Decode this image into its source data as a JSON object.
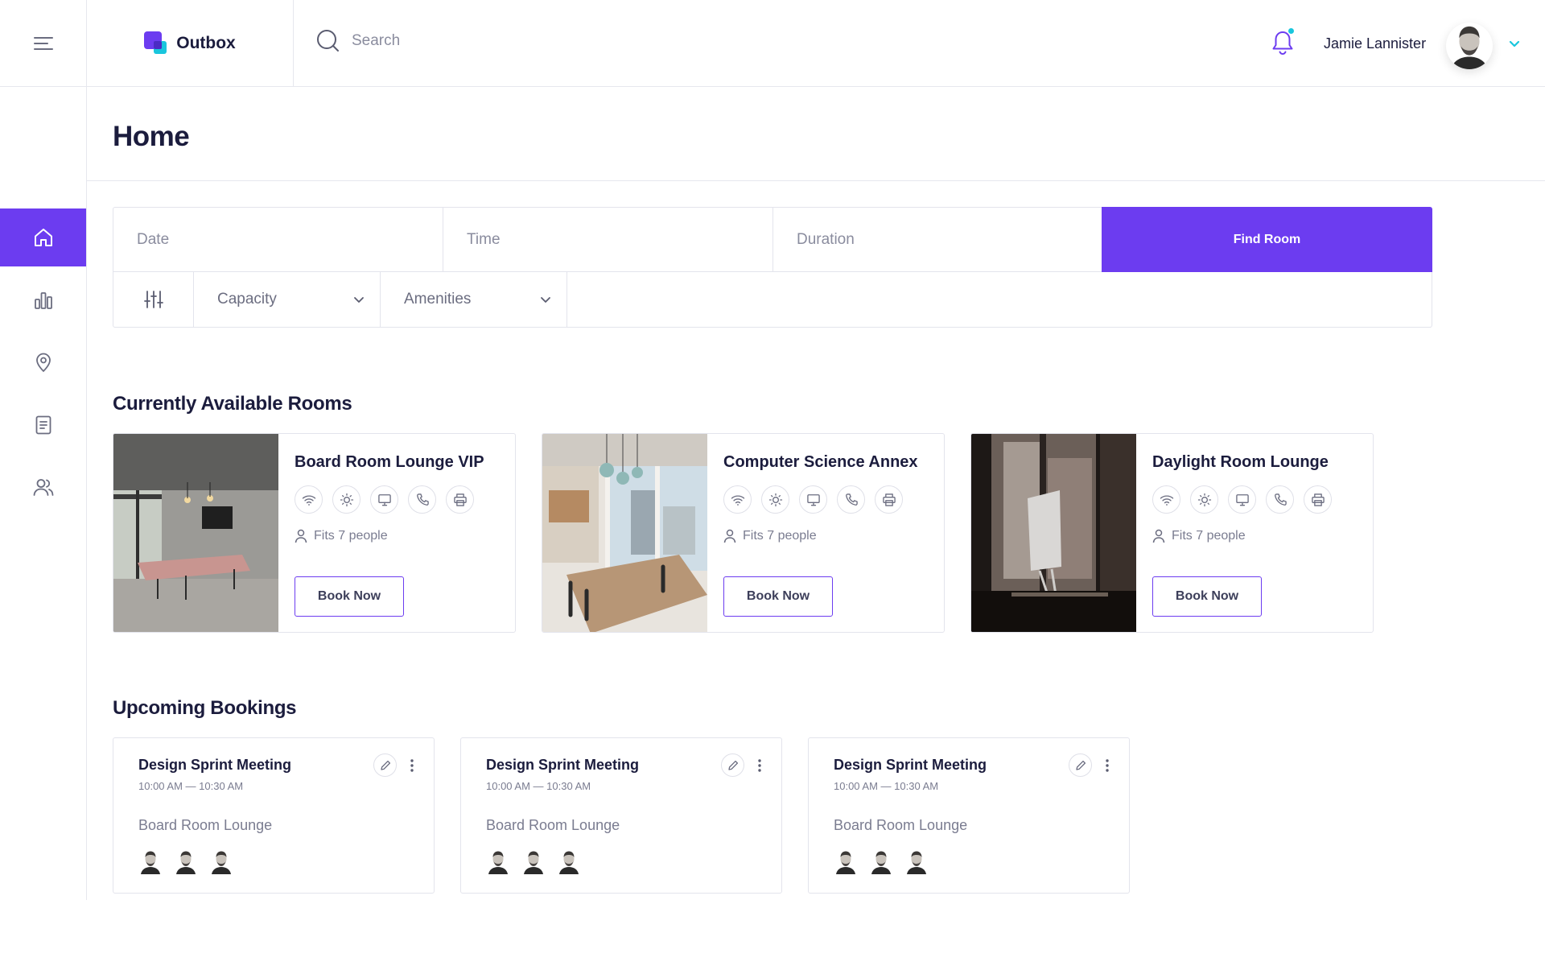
{
  "app": {
    "name": "Outbox"
  },
  "colors": {
    "accent": "#6c3cf0",
    "secondary": "#19c6dd",
    "text": "#1b1c3d",
    "muted": "#8a8c9e",
    "border": "#e3e4ec"
  },
  "header": {
    "search_placeholder": "Search",
    "user_name": "Jamie Lannister",
    "notification_icon": "bell-icon"
  },
  "sidebar": {
    "items": [
      {
        "icon": "home-icon",
        "active": true
      },
      {
        "icon": "bar-chart-icon",
        "active": false
      },
      {
        "icon": "location-pin-icon",
        "active": false
      },
      {
        "icon": "document-icon",
        "active": false
      },
      {
        "icon": "users-icon",
        "active": false
      }
    ]
  },
  "page": {
    "title": "Home"
  },
  "finder": {
    "date_placeholder": "Date",
    "time_placeholder": "Time",
    "duration_placeholder": "Duration",
    "find_button": "Find Room",
    "capacity_label": "Capacity",
    "amenities_label": "Amenities"
  },
  "sections": {
    "available": "Currently Available Rooms",
    "upcoming": "Upcoming Bookings"
  },
  "rooms": [
    {
      "name": "Board Room Lounge VIP",
      "fits": "Fits 7 people",
      "book_label": "Book Now",
      "amenities": [
        "wifi-icon",
        "light-icon",
        "monitor-icon",
        "phone-icon",
        "printer-icon"
      ]
    },
    {
      "name": "Computer Science Annex",
      "fits": "Fits 7 people",
      "book_label": "Book Now",
      "amenities": [
        "wifi-icon",
        "light-icon",
        "monitor-icon",
        "phone-icon",
        "printer-icon"
      ]
    },
    {
      "name": "Daylight Room Lounge",
      "fits": "Fits 7 people",
      "book_label": "Book Now",
      "amenities": [
        "wifi-icon",
        "light-icon",
        "monitor-icon",
        "phone-icon",
        "printer-icon"
      ]
    }
  ],
  "bookings": [
    {
      "title": "Design Sprint Meeting",
      "time": "10:00 AM — 10:30 AM",
      "room": "Board Room Lounge"
    },
    {
      "title": "Design Sprint Meeting",
      "time": "10:00 AM — 10:30 AM",
      "room": "Board Room Lounge"
    },
    {
      "title": "Design Sprint Meeting",
      "time": "10:00 AM — 10:30 AM",
      "room": "Board Room Lounge"
    }
  ]
}
